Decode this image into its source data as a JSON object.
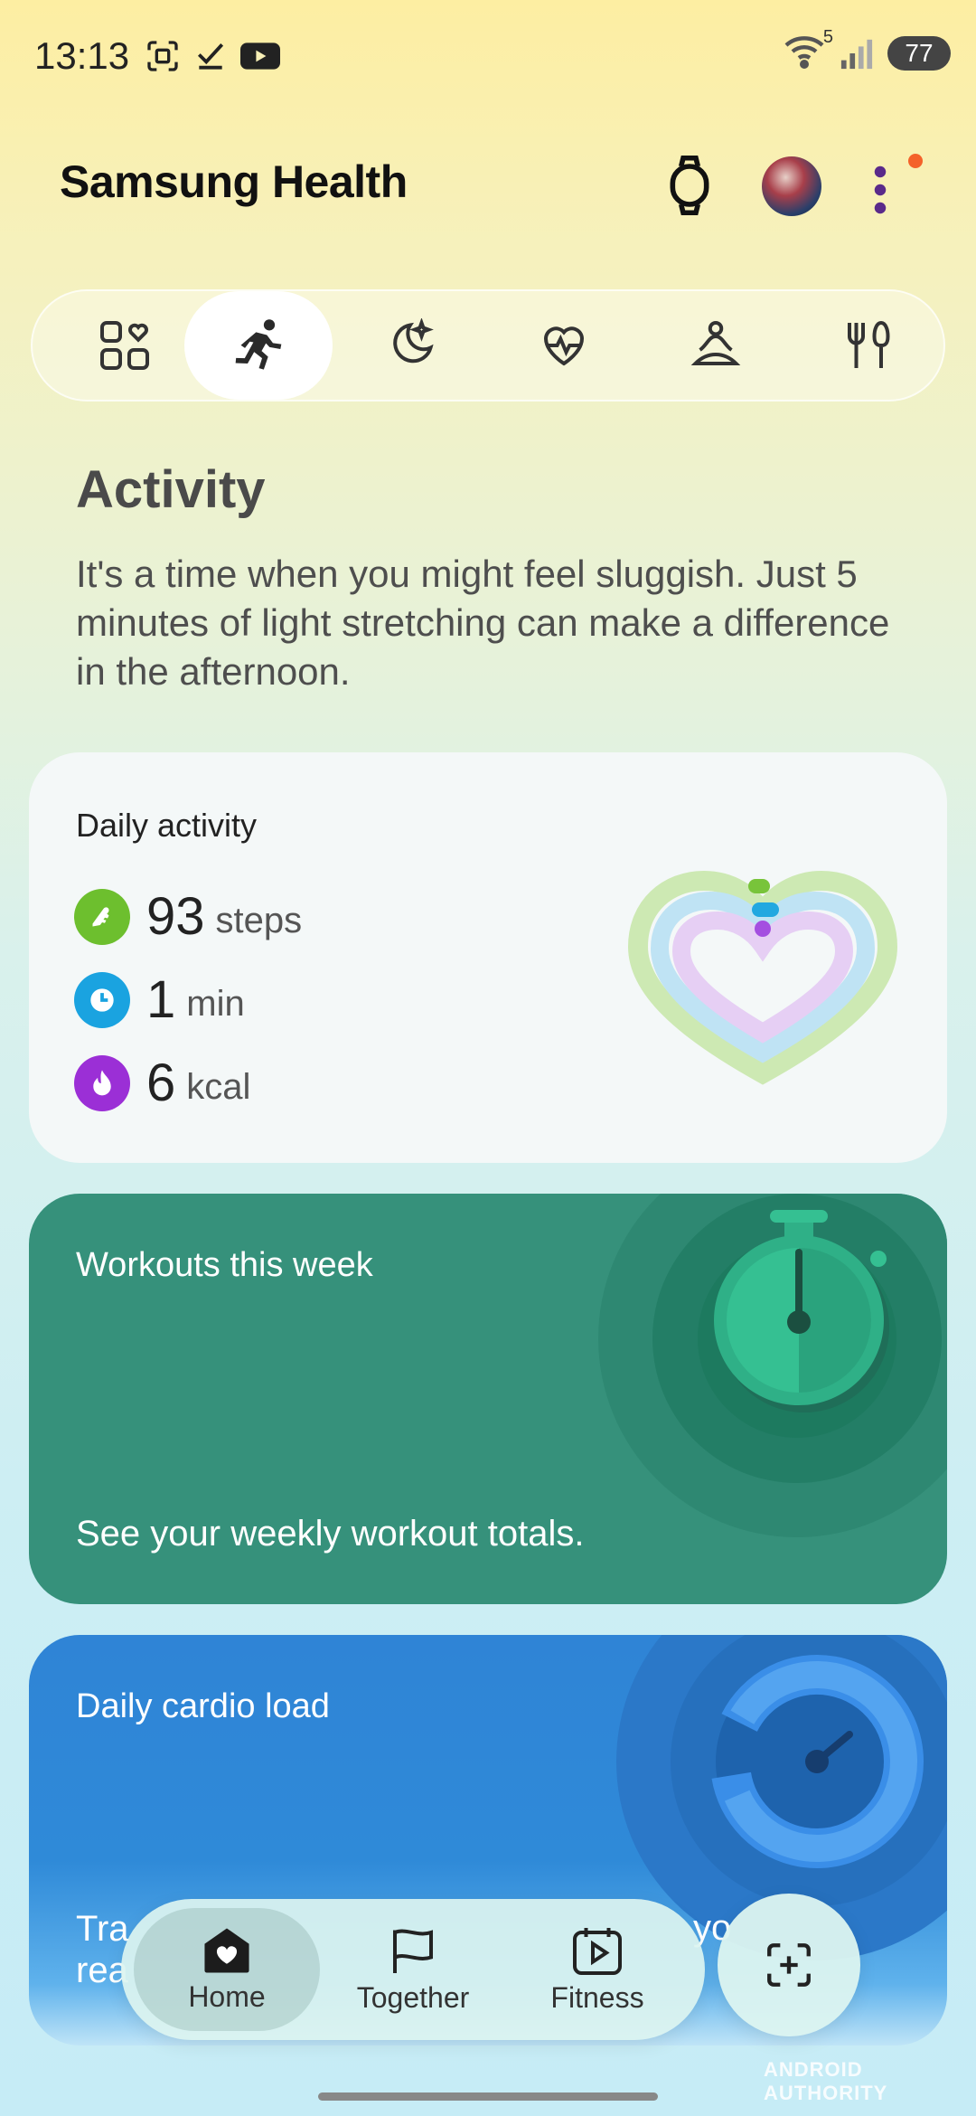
{
  "status_bar": {
    "time": "13:13",
    "wifi_badge": "5",
    "battery": "77",
    "icons": [
      "screenshot-icon",
      "checkmark-icon",
      "youtube-icon",
      "wifi-icon",
      "signal-icon",
      "battery-icon"
    ]
  },
  "header": {
    "title": "Samsung Health",
    "icons": [
      "watch-icon",
      "avatar",
      "more-vert-icon"
    ]
  },
  "tabs": [
    {
      "icon": "dashboard-icon",
      "active": false
    },
    {
      "icon": "activity-run-icon",
      "active": true
    },
    {
      "icon": "sleep-icon",
      "active": false
    },
    {
      "icon": "heart-rate-icon",
      "active": false
    },
    {
      "icon": "mindfulness-icon",
      "active": false
    },
    {
      "icon": "food-icon",
      "active": false
    }
  ],
  "section": {
    "title": "Activity",
    "description": "It's a time when you might feel sluggish. Just 5 minutes of light stretching can make a difference in the afternoon."
  },
  "daily_activity": {
    "label": "Daily activity",
    "steps": {
      "value": "93",
      "unit": "steps",
      "color": "#6dbf2e"
    },
    "minutes": {
      "value": "1",
      "unit": "min",
      "color": "#1aa3e0"
    },
    "kcal": {
      "value": "6",
      "unit": "kcal",
      "color": "#9b2fd6"
    }
  },
  "workouts": {
    "label": "Workouts this week",
    "subtitle": "See your weekly workout totals."
  },
  "cardio": {
    "label": "Daily cardio load",
    "subtitle_partial": "Tra",
    "subtitle_partial_2": "rea",
    "subtitle_partial_right": "yo"
  },
  "bottom_nav": {
    "items": [
      {
        "label": "Home",
        "icon": "home-heart-icon",
        "active": true
      },
      {
        "label": "Together",
        "icon": "flag-icon",
        "active": false
      },
      {
        "label": "Fitness",
        "icon": "calendar-play-icon",
        "active": false
      }
    ],
    "fab_icon": "add-record-icon"
  },
  "watermark": "ANDROID AUTHORITY",
  "colors": {
    "workouts_card": "#36917b",
    "cardio_card": "#2f84d6",
    "notification_dot": "#f4622a"
  }
}
